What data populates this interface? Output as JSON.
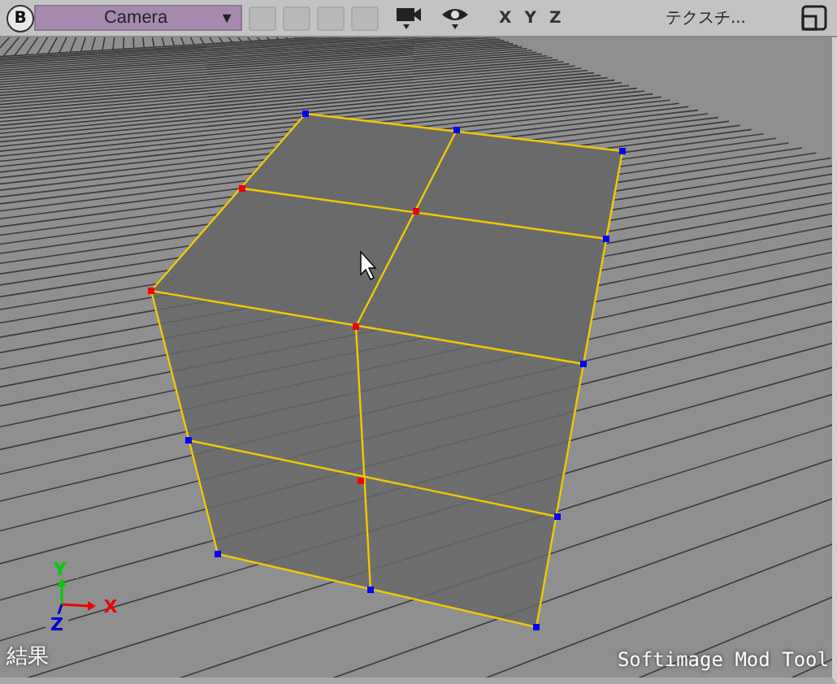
{
  "toolbar": {
    "view_button": "B",
    "camera_menu": {
      "label": "Camera",
      "caret": "▼"
    },
    "axis_buttons": [
      "X",
      "Y",
      "Z"
    ],
    "display_menu": "テクスチ..."
  },
  "viewport": {
    "axes": {
      "x": "X",
      "y": "Y",
      "z": "Z"
    },
    "mode_label": "結果",
    "product_label": "Softimage Mod Tool"
  }
}
